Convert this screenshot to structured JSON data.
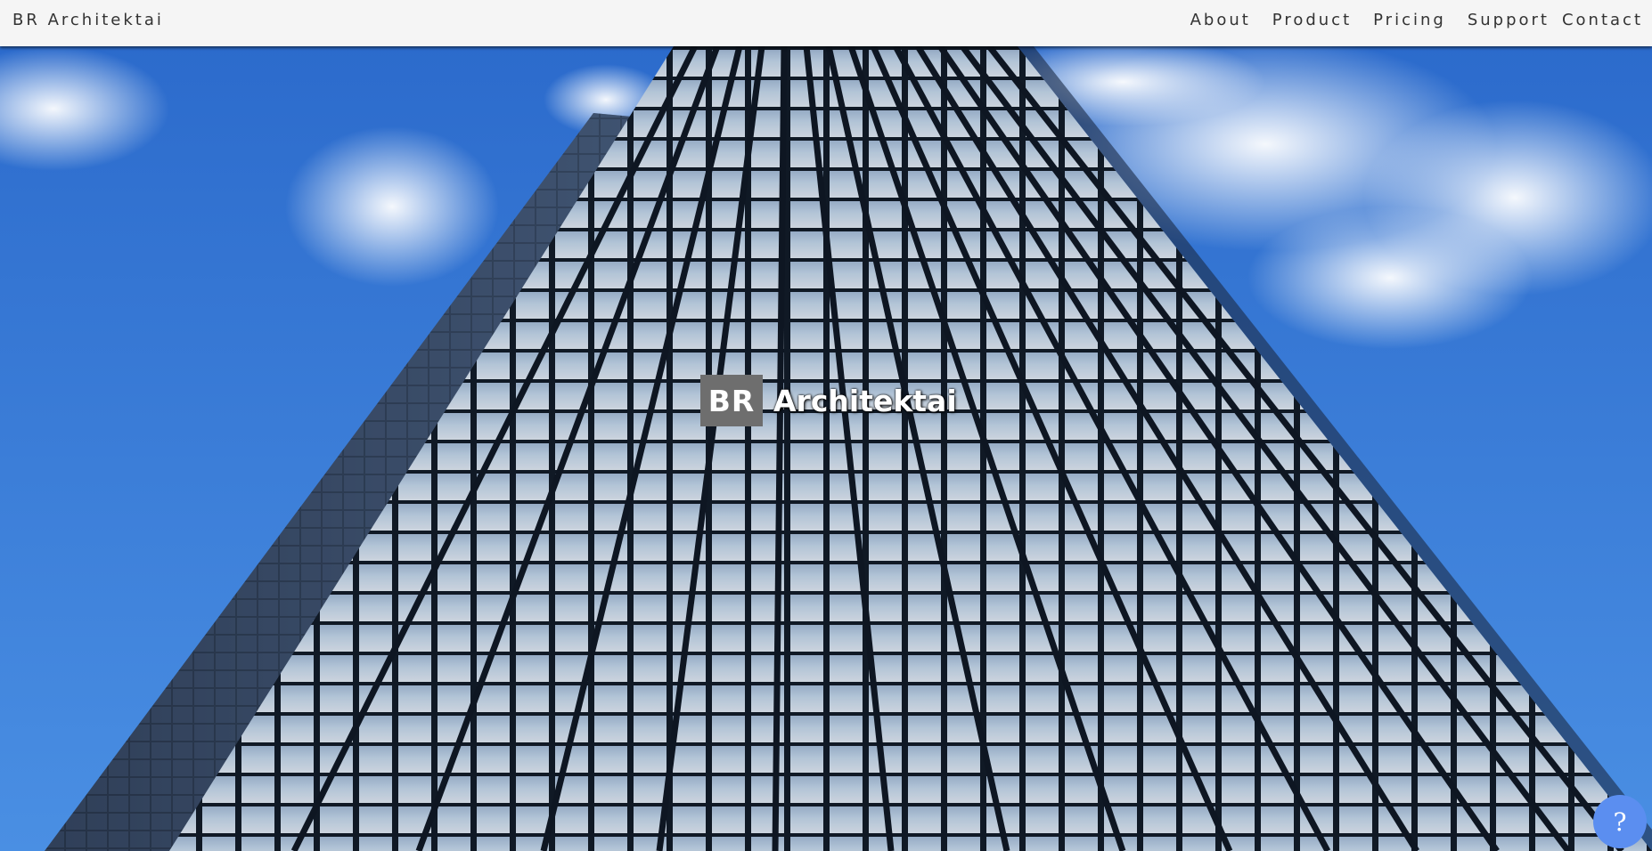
{
  "header": {
    "brand": "BR Architektai",
    "nav": [
      {
        "label": "About"
      },
      {
        "label": "Product"
      },
      {
        "label": "Pricing"
      },
      {
        "label": "Support"
      },
      {
        "label": "Contact"
      }
    ]
  },
  "hero": {
    "logo_box": "BR",
    "logo_text": "Architektai",
    "background": "glass-skyscraper-photo"
  },
  "help": {
    "label": "?",
    "icon": "question-icon"
  },
  "colors": {
    "nav_bg": "#f5f5f5",
    "sky": "#3e83dd",
    "logo_box": "#6e6e6e",
    "help_button": "#5b8ef0"
  }
}
